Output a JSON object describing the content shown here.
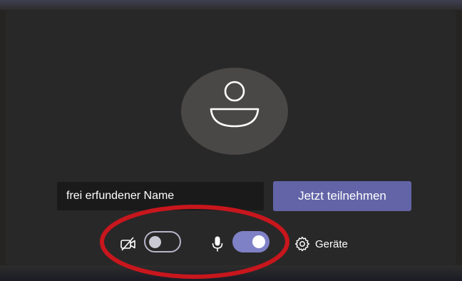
{
  "prejoin": {
    "name_field": {
      "value": "frei erfundener Name",
      "placeholder": ""
    },
    "join_button_label": "Jetzt teilnehmen",
    "camera": {
      "icon": "camera-off-icon",
      "enabled": false
    },
    "microphone": {
      "icon": "microphone-icon",
      "enabled": true
    },
    "devices": {
      "icon": "gear-icon",
      "label": "Geräte"
    }
  },
  "colors": {
    "accent": "#6264a7",
    "toggle_on": "#7f81c6",
    "annotation": "#c8161d",
    "background": "#292828"
  }
}
